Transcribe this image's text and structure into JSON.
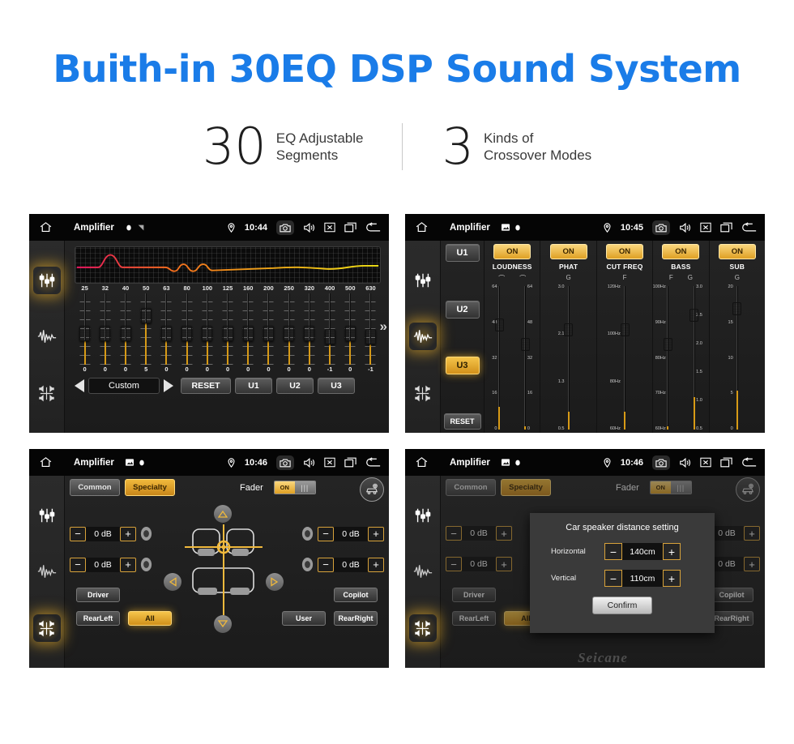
{
  "header": {
    "title": "Buith-in 30EQ DSP Sound System",
    "accent_color": "#1a7ce8",
    "stats": [
      {
        "number": "30",
        "label": "EQ Adjustable\nSegments"
      },
      {
        "number": "3",
        "label": "Kinds of\nCrossover Modes"
      }
    ]
  },
  "panel1": {
    "statusbar": {
      "title": "Amplifier",
      "time": "10:44"
    },
    "sidebar": [
      {
        "name": "eq-sliders-icon",
        "active": true
      },
      {
        "name": "waveform-icon",
        "active": false
      },
      {
        "name": "balance-icon",
        "active": false
      }
    ],
    "eq": {
      "frequencies": [
        "25",
        "32",
        "40",
        "50",
        "63",
        "80",
        "100",
        "125",
        "160",
        "200",
        "250",
        "320",
        "400",
        "500",
        "630"
      ],
      "values": [
        "0",
        "0",
        "0",
        "5",
        "0",
        "0",
        "0",
        "0",
        "0",
        "0",
        "0",
        "0",
        "-1",
        "0",
        "-1"
      ],
      "gain_levels": [
        0,
        0,
        0,
        5,
        0,
        0,
        0,
        0,
        0,
        0,
        0,
        0,
        -1,
        0,
        -1
      ]
    },
    "controls": {
      "prev": "◀",
      "preset": "Custom",
      "next": "▶",
      "reset": "RESET",
      "u1": "U1",
      "u2": "U2",
      "u3": "U3",
      "more": "»"
    }
  },
  "panel2": {
    "statusbar": {
      "title": "Amplifier",
      "time": "10:45"
    },
    "sidebar": [
      {
        "name": "eq-sliders-icon",
        "active": false
      },
      {
        "name": "waveform-icon",
        "active": true
      },
      {
        "name": "balance-icon",
        "active": false
      }
    ],
    "presets": [
      {
        "label": "U1",
        "active": false
      },
      {
        "label": "U2",
        "active": false
      },
      {
        "label": "U3",
        "active": true
      },
      {
        "label": "RESET",
        "active": false
      }
    ],
    "columns": [
      {
        "name": "LOUDNESS",
        "on": "ON",
        "sub": [
          "⌒",
          "⌒"
        ],
        "faders": [
          {
            "scale": [
              "64",
              "48",
              "32",
              "16",
              "0"
            ],
            "pos": 42,
            "side": "left"
          },
          {
            "scale": [
              "64",
              "48",
              "32",
              "16",
              "0"
            ],
            "pos": 8,
            "side": "right"
          }
        ]
      },
      {
        "name": "PHAT",
        "on": "ON",
        "sub": [
          "G"
        ],
        "faders": [
          {
            "scale": [
              "3.0",
              "2.1",
              "1.3",
              "0.5"
            ],
            "pos": 33,
            "side": "left"
          }
        ]
      },
      {
        "name": "CUT FREQ",
        "on": "ON",
        "sub": [
          "F"
        ],
        "faders": [
          {
            "scale": [
              "120Hz",
              "100Hz",
              "80Hz",
              "60Hz"
            ],
            "pos": 33,
            "side": "left"
          }
        ]
      },
      {
        "name": "BASS",
        "on": "ON",
        "sub": [
          "F",
          "G"
        ],
        "faders": [
          {
            "scale": [
              "100Hz",
              "90Hz",
              "80Hz",
              "70Hz",
              "60Hz"
            ],
            "pos": 8,
            "side": "left"
          },
          {
            "scale": [
              "3.0",
              "2.5",
              "2.0",
              "1.5",
              "1.0",
              "0.5"
            ],
            "pos": 58,
            "side": "right"
          }
        ]
      },
      {
        "name": "SUB",
        "on": "ON",
        "sub": [
          "G"
        ],
        "faders": [
          {
            "scale": [
              "20",
              "15",
              "10",
              "5",
              "0"
            ],
            "pos": 70,
            "side": "left"
          }
        ]
      }
    ]
  },
  "panel3": {
    "statusbar": {
      "title": "Amplifier",
      "time": "10:46"
    },
    "sidebar": [
      {
        "name": "eq-sliders-icon",
        "active": false
      },
      {
        "name": "waveform-icon",
        "active": false
      },
      {
        "name": "balance-icon",
        "active": true
      }
    ],
    "tabs": [
      {
        "label": "Common",
        "active": false
      },
      {
        "label": "Specialty",
        "active": true
      }
    ],
    "fader": {
      "label": "Fader",
      "toggle_state": "ON"
    },
    "db_controls": [
      {
        "position": "front-left",
        "minus": "−",
        "value": "0 dB",
        "plus": "+"
      },
      {
        "position": "front-right",
        "minus": "−",
        "value": "0 dB",
        "plus": "+"
      },
      {
        "position": "rear-left",
        "minus": "−",
        "value": "0 dB",
        "plus": "+"
      },
      {
        "position": "rear-right",
        "minus": "−",
        "value": "0 dB",
        "plus": "+"
      }
    ],
    "seat_buttons": [
      {
        "label": "Driver",
        "active": false
      },
      {
        "label": "RearLeft",
        "active": false
      },
      {
        "label": "All",
        "active": true
      },
      {
        "label": "User",
        "active": false
      },
      {
        "label": "Copilot",
        "active": false
      },
      {
        "label": "RearRight",
        "active": false
      }
    ]
  },
  "panel4": {
    "statusbar": {
      "title": "Amplifier",
      "time": "10:46"
    },
    "dialog": {
      "title": "Car speaker distance setting",
      "rows": [
        {
          "label": "Horizontal",
          "minus": "−",
          "value": "140cm",
          "plus": "+"
        },
        {
          "label": "Vertical",
          "minus": "−",
          "value": "110cm",
          "plus": "+"
        }
      ],
      "confirm": "Confirm"
    },
    "watermark": "Seicane"
  }
}
